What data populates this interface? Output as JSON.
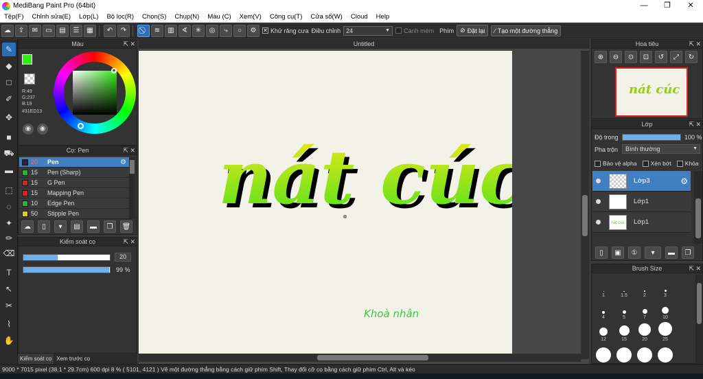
{
  "window": {
    "title": "MediBang Paint Pro (64bit)",
    "minimize": "—",
    "maximize": "❐",
    "close": "✕"
  },
  "menu": [
    "Tệp(F)",
    "Chỉnh sửa(E)",
    "Lớp(L)",
    "Bộ lọc(R)",
    "Chọn(S)",
    "Chụp(N)",
    "Màu (C)",
    "Xem(V)",
    "Công cụ(T)",
    "Cửa sổ(W)",
    "Cloud",
    "Help"
  ],
  "toolbar": {
    "antialias_label": "Khử răng cưa",
    "antialias_checked": true,
    "adjust_label": "Điều chỉnh",
    "adjust_value": "24",
    "edge_label": "Canh mém",
    "key_label": "Phím",
    "reset_label": "Đặt lại",
    "straight_label": "Tạo một đường thẳng"
  },
  "color_panel": {
    "title": "Màu",
    "r": "R:49",
    "g": "G:237",
    "b": "B:19",
    "hex": "#31ED13",
    "current_color": "#31ED13"
  },
  "brush_panel": {
    "title": "Cọ: Pen",
    "items": [
      {
        "size": "20",
        "name": "Pen",
        "color": "#1e2a3a",
        "selected": true
      },
      {
        "size": "15",
        "name": "Pen (Sharp)",
        "color": "#22bb22"
      },
      {
        "size": "15",
        "name": "G Pen",
        "color": "#dd2222"
      },
      {
        "size": "15",
        "name": "Mapping Pen",
        "color": "#dd2222"
      },
      {
        "size": "10",
        "name": "Edge Pen",
        "color": "#22bb22"
      },
      {
        "size": "50",
        "name": "Stipple Pen",
        "color": "#ddcc22"
      }
    ]
  },
  "brush_control": {
    "title": "Kiểm soát cọ",
    "size": "20",
    "size_level": 0.4,
    "opacity": "99 %",
    "opacity_level": 0.99
  },
  "bottom_tabs": [
    "Kiểm soát cọ",
    "Xem trước cọ"
  ],
  "document": {
    "tab": "Untitled",
    "artwork_text": "nát cúc",
    "signature": "Khoà nhân"
  },
  "navigator": {
    "title": "Hoa tiêu",
    "thumb_text": "nát cúc"
  },
  "layer_panel": {
    "title": "Lớp",
    "opacity_label": "Độ trong",
    "opacity_value": "100 %",
    "opacity_level": 1.0,
    "blend_label": "Pha trộn",
    "blend_value": "Bình thường",
    "protect_alpha": "Bảo vệ alpha",
    "clip": "Xén bớt",
    "lock": "Khóa",
    "layers": [
      {
        "name": "Lớp3",
        "selected": true,
        "thumb": ""
      },
      {
        "name": "Lớp1",
        "selected": false,
        "thumb": ""
      },
      {
        "name": "Lớp1",
        "selected": false,
        "thumb": "nát cúc"
      }
    ]
  },
  "brush_size_panel": {
    "title": "Brush Size",
    "sizes": [
      "1",
      "1.5",
      "2",
      "3",
      "4",
      "5",
      "7",
      "10",
      "12",
      "15",
      "20",
      "25"
    ]
  },
  "status": "9000 * 7015 pixel   (38.1 * 29.7cm)   600 dpi   8 %   ( 5101, 4121 )   Vẽ một đường thẳng bằng cách giữ phím Shift, Thay đổi cỡ cọ bằng cách giữ phím Ctrl, Alt và kéo"
}
